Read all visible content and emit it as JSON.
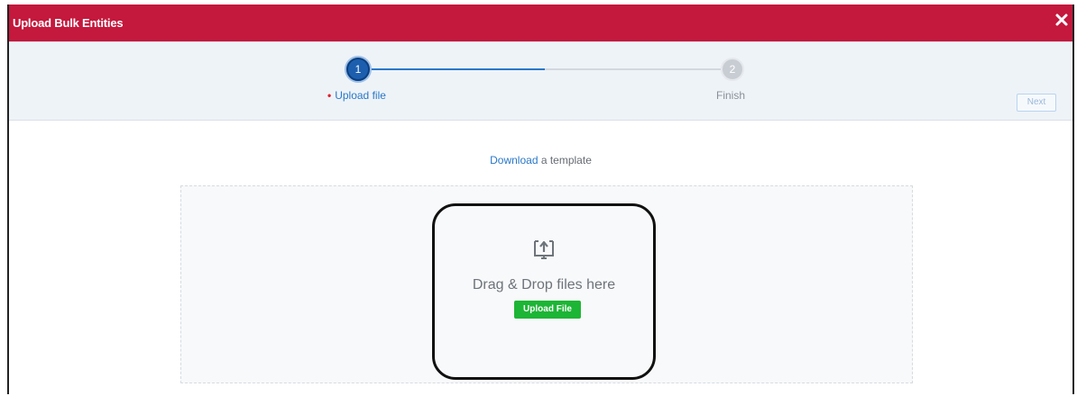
{
  "dialog": {
    "title": "Upload Bulk Entities",
    "close_icon": "close-icon"
  },
  "stepper": {
    "steps": [
      {
        "number": "1",
        "label": "Upload file",
        "state": "active"
      },
      {
        "number": "2",
        "label": "Finish",
        "state": "pending"
      }
    ],
    "next_label": "Next"
  },
  "download": {
    "link_text": "Download",
    "suffix_text": " a template"
  },
  "dropzone": {
    "icon": "upload-monitor-icon",
    "text": "Drag & Drop files here",
    "button_label": "Upload File"
  },
  "colors": {
    "title_bar": "#c4183c",
    "accent_blue": "#2a78c8",
    "upload_green": "#1db535",
    "required_dot": "#e0202a"
  }
}
